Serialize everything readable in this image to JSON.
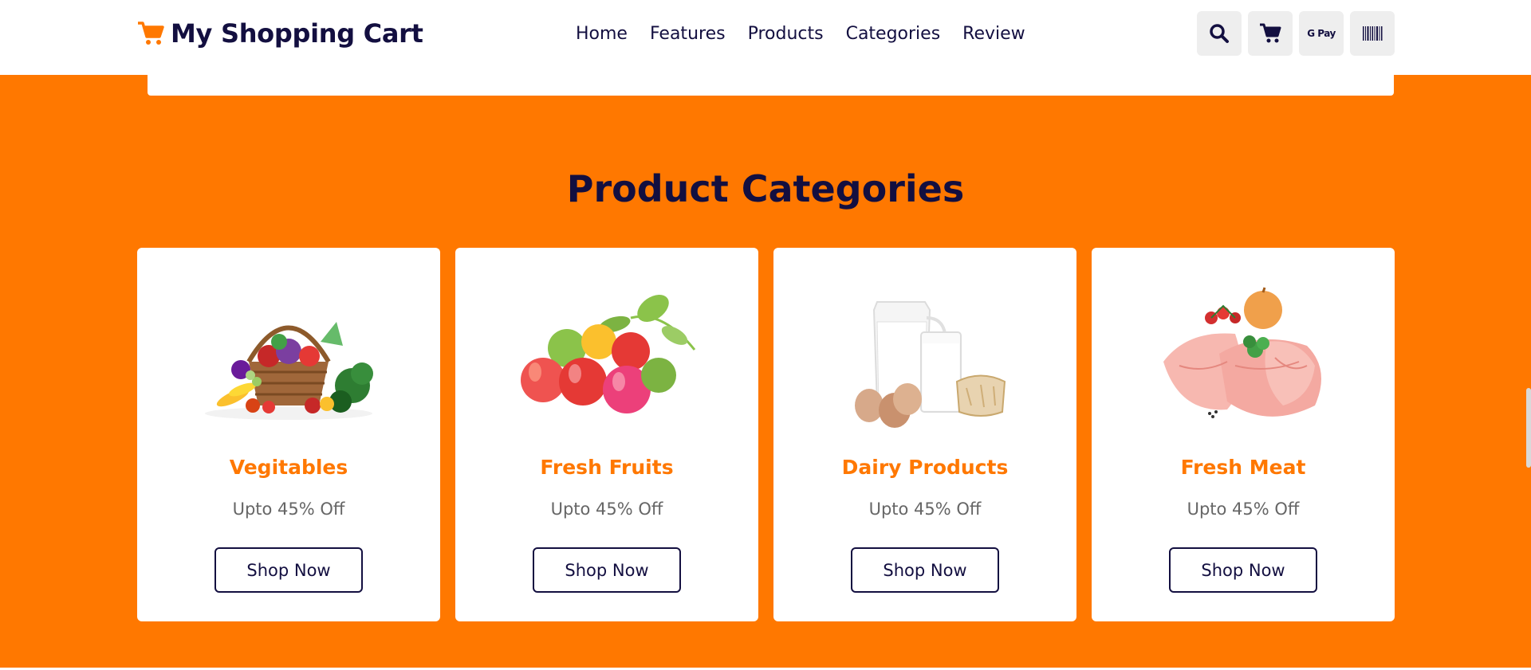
{
  "header": {
    "logo_text": "My Shopping Cart",
    "nav": [
      {
        "label": "Home"
      },
      {
        "label": "Features"
      },
      {
        "label": "Products"
      },
      {
        "label": "Categories"
      },
      {
        "label": "Review"
      }
    ],
    "icons": [
      "search-icon",
      "cart-icon",
      "google-pay-icon",
      "barcode-icon"
    ],
    "gpay_label": "G Pay"
  },
  "section": {
    "title": "Product Categories"
  },
  "categories": [
    {
      "title": "Vegitables",
      "discount": "Upto 45% Off",
      "button": "Shop Now",
      "image": "vegetable-basket"
    },
    {
      "title": "Fresh Fruits",
      "discount": "Upto 45% Off",
      "button": "Shop Now",
      "image": "apples"
    },
    {
      "title": "Dairy Products",
      "discount": "Upto 45% Off",
      "button": "Shop Now",
      "image": "milk-eggs-bread"
    },
    {
      "title": "Fresh Meat",
      "discount": "Upto 45% Off",
      "button": "Shop Now",
      "image": "chicken-breast"
    }
  ],
  "colors": {
    "accent": "#ff7800",
    "dark": "#130f40",
    "muted": "#666666"
  }
}
